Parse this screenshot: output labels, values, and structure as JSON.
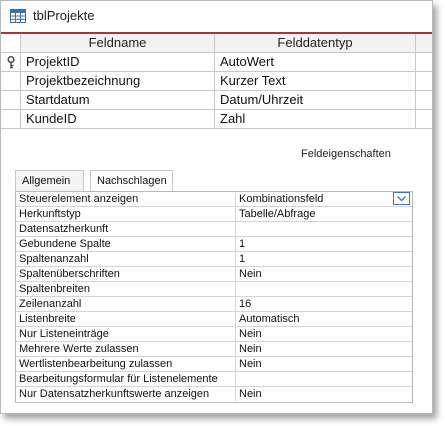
{
  "window": {
    "title": "tblProjekte",
    "accent_color": "#a4373a"
  },
  "grid": {
    "headers": [
      "Feldname",
      "Felddatentyp"
    ],
    "rows": [
      {
        "name": "ProjektID",
        "type": "AutoWert",
        "primary_key": true
      },
      {
        "name": "Projektbezeichnung",
        "type": "Kurzer Text",
        "primary_key": false
      },
      {
        "name": "Startdatum",
        "type": "Datum/Uhrzeit",
        "primary_key": false
      },
      {
        "name": "KundeID",
        "type": "Zahl",
        "primary_key": false
      }
    ]
  },
  "field_properties": {
    "label": "Feldeigenschaften",
    "tabs": [
      "Allgemein",
      "Nachschlagen"
    ],
    "active_tab": "Nachschlagen",
    "rows": [
      {
        "label": "Steuerelement anzeigen",
        "value": "Kombinationsfeld"
      },
      {
        "label": "Herkunftstyp",
        "value": "Tabelle/Abfrage"
      },
      {
        "label": "Datensatzherkunft",
        "value": ""
      },
      {
        "label": "Gebundene Spalte",
        "value": "1"
      },
      {
        "label": "Spaltenanzahl",
        "value": "1"
      },
      {
        "label": "Spaltenüberschriften",
        "value": "Nein"
      },
      {
        "label": "Spaltenbreiten",
        "value": ""
      },
      {
        "label": "Zeilenanzahl",
        "value": "16"
      },
      {
        "label": "Listenbreite",
        "value": "Automatisch"
      },
      {
        "label": "Nur Listeneinträge",
        "value": "Nein"
      },
      {
        "label": "Mehrere Werte zulassen",
        "value": "Nein"
      },
      {
        "label": "Wertlistenbearbeitung zulassen",
        "value": "Nein"
      },
      {
        "label": "Bearbeitungsformular für Listenelemente",
        "value": ""
      },
      {
        "label": "Nur Datensatzherkunftswerte anzeigen",
        "value": "Nein"
      }
    ]
  },
  "icons": {
    "title": "table-icon",
    "primary_key": "key-icon",
    "dropdown": "chevron-down-icon"
  }
}
